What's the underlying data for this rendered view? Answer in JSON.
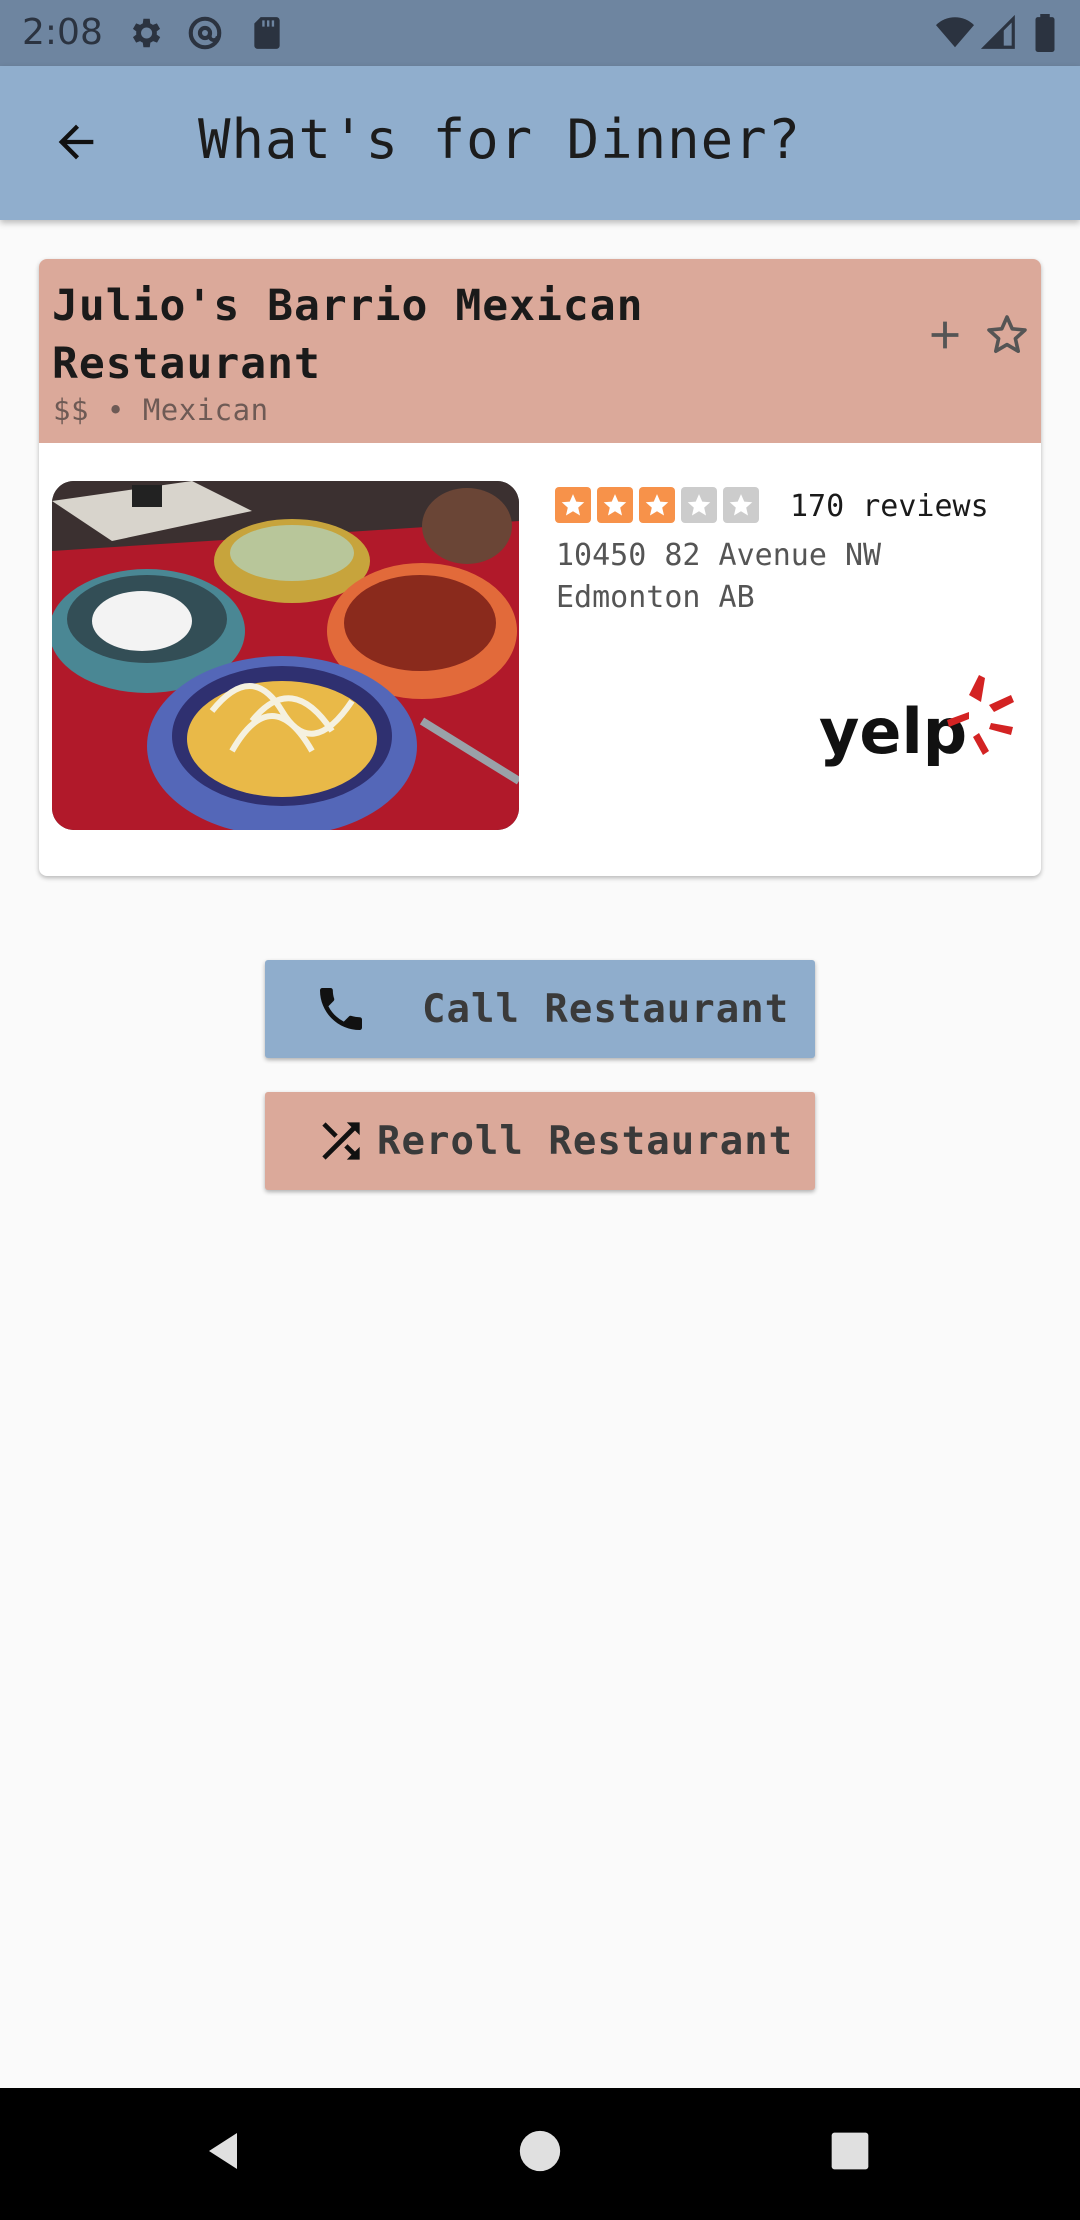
{
  "status_bar": {
    "time": "2:08",
    "icons": [
      "settings-icon",
      "at-sign-icon",
      "sd-card-icon",
      "wifi-icon",
      "signal-icon",
      "battery-icon"
    ]
  },
  "app_bar": {
    "title": "What's for Dinner?",
    "back_icon": "arrow-left-icon"
  },
  "restaurant": {
    "name": "Julio's Barrio Mexican Restaurant",
    "price": "$$",
    "separator": "•",
    "category": "Mexican",
    "rating": 3,
    "rating_max": 5,
    "reviews": "170 reviews",
    "address_line1": "10450 82 Avenue NW",
    "address_line2": "Edmonton AB",
    "logo_text": "yelp",
    "photo": "food-photo"
  },
  "actions": {
    "add_icon": "plus-icon",
    "favorite_icon": "star-outline-icon",
    "call_label": "Call Restaurant",
    "call_icon": "phone-icon",
    "reroll_label": "Reroll Restaurant",
    "reroll_icon": "shuffle-icon"
  },
  "nav": {
    "icons": [
      "back-triangle-icon",
      "home-circle-icon",
      "recents-square-icon"
    ]
  },
  "colors": {
    "status_bar": "#6e85a0",
    "app_bar": "#90aecd",
    "card_header": "#dba99a",
    "call_button": "#8fadcc",
    "reroll_button": "#dba99a",
    "star_filled": "#f7924a",
    "star_empty": "#cccccc",
    "yelp_red": "#d32323"
  }
}
